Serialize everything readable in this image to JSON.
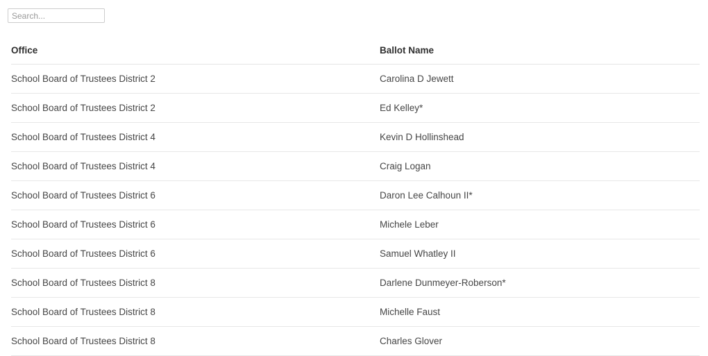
{
  "search": {
    "placeholder": "Search...",
    "value": ""
  },
  "table": {
    "columns": [
      {
        "key": "office",
        "label": "Office"
      },
      {
        "key": "ballot_name",
        "label": "Ballot Name"
      }
    ],
    "rows": [
      {
        "office": "School Board of Trustees District 2",
        "ballot_name": "Carolina D Jewett"
      },
      {
        "office": "School Board of Trustees District 2",
        "ballot_name": "Ed Kelley*"
      },
      {
        "office": "School Board of Trustees District 4",
        "ballot_name": "Kevin D Hollinshead"
      },
      {
        "office": "School Board of Trustees District 4",
        "ballot_name": "Craig Logan"
      },
      {
        "office": "School Board of Trustees District 6",
        "ballot_name": "Daron Lee Calhoun II*"
      },
      {
        "office": "School Board of Trustees District 6",
        "ballot_name": "Michele Leber"
      },
      {
        "office": "School Board of Trustees District 6",
        "ballot_name": "Samuel Whatley II"
      },
      {
        "office": "School Board of Trustees District 8",
        "ballot_name": "Darlene Dunmeyer-Roberson*"
      },
      {
        "office": "School Board of Trustees District 8",
        "ballot_name": "Michelle Faust"
      },
      {
        "office": "School Board of Trustees District 8",
        "ballot_name": "Charles Glover"
      }
    ]
  },
  "colors": {
    "background": "#ffffff",
    "text": "#454545",
    "header_text": "#2f2f2f",
    "border": "#e7e7e7",
    "input_border": "#cccccc",
    "placeholder": "#999999"
  }
}
